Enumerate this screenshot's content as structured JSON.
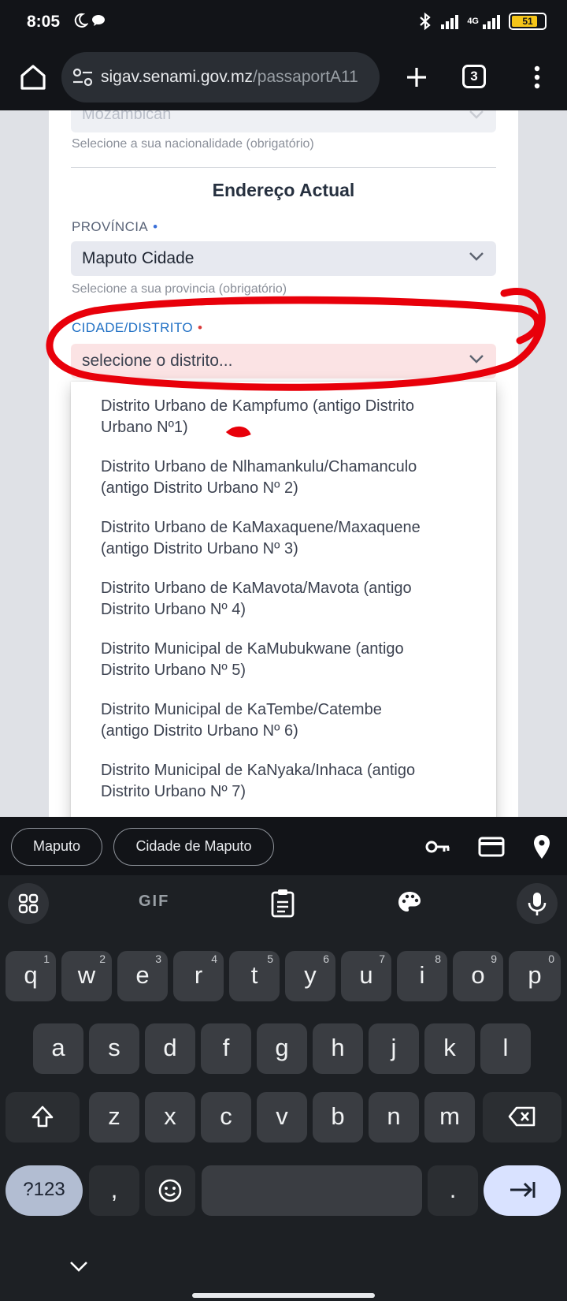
{
  "status_bar": {
    "time": "8:05",
    "network": "4G",
    "battery": "51"
  },
  "browser": {
    "url_domain": "sigav.senami.gov.mz",
    "url_path": "/passaportA11",
    "tab_count": "3"
  },
  "form": {
    "nationality_value": "Mozambican",
    "nationality_helper": "Selecione a sua nacionalidade (obrigatório)",
    "section_title": "Endereço Actual",
    "province_label": "PROVÍNCIA",
    "province_required": "•",
    "province_value": "Maputo Cidade",
    "province_helper": "Selecione a sua provincia (obrigatório)",
    "district_label": "CIDADE/DISTRITO",
    "district_required": "•",
    "district_placeholder": "selecione o distrito...",
    "district_options": [
      {
        "line1": "Distrito Urbano de Kampfumo (antigo Distrito",
        "line2": "Urbano Nº1)"
      },
      {
        "line1": "Distrito Urbano de Nlhamankulu/Chamanculo",
        "line2": "(antigo Distrito Urbano Nº 2)"
      },
      {
        "line1": "Distrito Urbano de KaMaxaquene/Maxaquene",
        "line2": "(antigo Distrito Urbano Nº 3)"
      },
      {
        "line1": "Distrito Urbano de KaMavota/Mavota (antigo",
        "line2": "Distrito Urbano Nº 4)"
      },
      {
        "line1": "Distrito Municipal de KaMubukwane (antigo",
        "line2": "Distrito Urbano Nº 5)"
      },
      {
        "line1": "Distrito Municipal de KaTembe/Catembe",
        "line2": "(antigo Distrito Urbano Nº 6)"
      },
      {
        "line1": "Distrito Municipal de KaNyaka/Inhaca (antigo",
        "line2": "Distrito Urbano Nº 7)"
      }
    ]
  },
  "colors": {
    "label_primary": "#5a6478",
    "label_active": "#1f6fc4",
    "required_dot_province": "#3a6fd8",
    "required_dot_district": "#d83a3a",
    "select_default_bg": "#e7e9f0",
    "select_error_bg": "#fbe3e4",
    "annotation_red": "#e8000a"
  },
  "autofill": {
    "chips": [
      "Maputo",
      "Cidade de Maputo"
    ],
    "icons": [
      "key-icon",
      "credit-card-icon",
      "location-pin-icon"
    ]
  },
  "keyboard": {
    "toolbar": [
      "apps-grid-icon",
      "GIF",
      "clipboard-icon",
      "palette-icon",
      "mic-icon"
    ],
    "gif_label": "GIF",
    "row1": [
      {
        "k": "q",
        "n": "1"
      },
      {
        "k": "w",
        "n": "2"
      },
      {
        "k": "e",
        "n": "3"
      },
      {
        "k": "r",
        "n": "4"
      },
      {
        "k": "t",
        "n": "5"
      },
      {
        "k": "y",
        "n": "6"
      },
      {
        "k": "u",
        "n": "7"
      },
      {
        "k": "i",
        "n": "8"
      },
      {
        "k": "o",
        "n": "9"
      },
      {
        "k": "p",
        "n": "0"
      }
    ],
    "row2": [
      "a",
      "s",
      "d",
      "f",
      "g",
      "h",
      "j",
      "k",
      "l"
    ],
    "row3": [
      "z",
      "x",
      "c",
      "v",
      "b",
      "n",
      "m"
    ],
    "mode_label": "?123",
    "comma": ",",
    "period": "."
  }
}
